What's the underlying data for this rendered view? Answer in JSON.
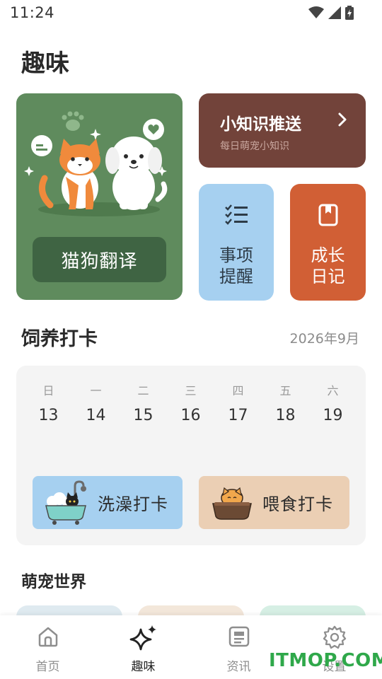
{
  "status_bar": {
    "time": "11:24",
    "icons": [
      "wifi-icon",
      "signal-icon",
      "battery-icon"
    ]
  },
  "page": {
    "title": "趣味"
  },
  "cards": {
    "translate": {
      "button_label": "猫狗翻译"
    },
    "tips": {
      "title": "小知识推送",
      "subtitle": "每日萌宠小知识"
    },
    "remind": {
      "line1": "事项",
      "line2": "提醒",
      "icon": "checklist-icon"
    },
    "diary": {
      "line1": "成长",
      "line2": "日记",
      "icon": "notebook-icon"
    }
  },
  "feeding": {
    "title": "饲养打卡",
    "month": "2026年9月",
    "days": [
      {
        "name": "日",
        "num": "13"
      },
      {
        "name": "一",
        "num": "14"
      },
      {
        "name": "二",
        "num": "15"
      },
      {
        "name": "三",
        "num": "16"
      },
      {
        "name": "四",
        "num": "17"
      },
      {
        "name": "五",
        "num": "18"
      },
      {
        "name": "六",
        "num": "19"
      }
    ],
    "bath_label": "洗澡打卡",
    "feed_label": "喂食打卡"
  },
  "world": {
    "title": "萌宠世界"
  },
  "nav": [
    {
      "label": "首页",
      "icon": "home-icon"
    },
    {
      "label": "趣味",
      "icon": "sparkle-icon",
      "active": true
    },
    {
      "label": "资讯",
      "icon": "news-icon"
    },
    {
      "label": "设置",
      "icon": "gear-icon"
    }
  ],
  "watermark": "ITMOP.COM",
  "colors": {
    "green_card": "#5f8b5d",
    "brown_card": "#72433a",
    "blue_card": "#a6d0f0",
    "orange_card": "#d15f35",
    "peach_button": "#ebcfb4"
  }
}
